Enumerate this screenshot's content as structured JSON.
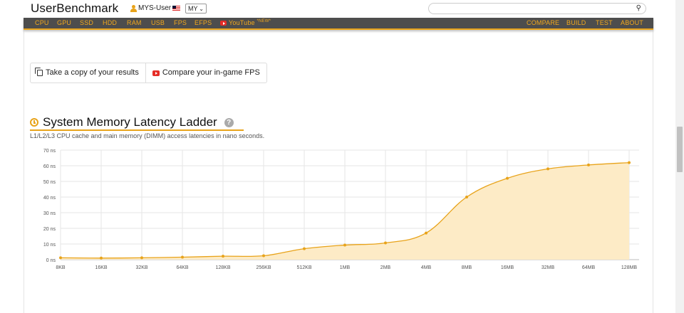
{
  "header": {
    "logo": "UserBenchmark",
    "user": "MYS-User",
    "region": "MY",
    "search_placeholder": ""
  },
  "nav": {
    "left": [
      "CPU",
      "GPU",
      "SSD",
      "HDD",
      "RAM",
      "USB",
      "FPS",
      "EFPS"
    ],
    "youtube": "YouTube",
    "new_badge": "*NEW*",
    "right": [
      "COMPARE",
      "BUILD",
      "TEST",
      "ABOUT"
    ]
  },
  "actions": {
    "copy": "Take a copy of your results",
    "compare": "Compare your in-game FPS"
  },
  "section": {
    "title": "System Memory Latency Ladder",
    "help": "?",
    "subtitle": "L1/L2/L3 CPU cache and main memory (DIMM) access latencies in nano seconds."
  },
  "colors": {
    "accent": "#e8a31a",
    "nav_bg": "#4d4d4d",
    "area_fill": "#fdebc6"
  },
  "chart_data": {
    "type": "area",
    "categories": [
      "8KB",
      "16KB",
      "32KB",
      "64KB",
      "128KB",
      "256KB",
      "512KB",
      "1MB",
      "2MB",
      "4MB",
      "8MB",
      "16MB",
      "32MB",
      "64MB",
      "128MB"
    ],
    "values": [
      1.2,
      1.0,
      1.2,
      1.6,
      2.2,
      2.5,
      7.0,
      9.3,
      10.7,
      17.0,
      40.0,
      52.0,
      58.0,
      60.5,
      62.0
    ],
    "y_ticks": [
      "0 ns",
      "10 ns",
      "20 ns",
      "30 ns",
      "40 ns",
      "50 ns",
      "60 ns",
      "70 ns"
    ],
    "ylim": [
      0,
      70
    ],
    "grid": true
  }
}
